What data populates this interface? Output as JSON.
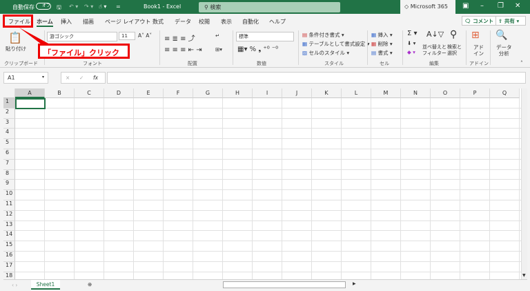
{
  "titlebar": {
    "autosave": "自動保存",
    "autosave_state": "オフ",
    "title": "Book1 - Excel",
    "search_placeholder": "検索",
    "ms365": "Microsoft 365",
    "bg": "#217346"
  },
  "tabs": [
    "ファイル",
    "ホーム",
    "挿入",
    "描画",
    "ページ レイアウト",
    "数式",
    "データ",
    "校閲",
    "表示",
    "自動化",
    "ヘルプ"
  ],
  "comment_button": "コメント",
  "share_button": "共有",
  "ribbon": {
    "clipboard": {
      "paste": "貼り付け",
      "group": "クリップボード"
    },
    "font": {
      "name": "游ゴシック",
      "size": "11",
      "group": "フォント"
    },
    "alignment": {
      "group": "配置"
    },
    "number": {
      "format": "標準",
      "group": "数値"
    },
    "styles": {
      "conditional": "条件付き書式",
      "table": "テーブルとして書式設定",
      "cell_styles": "セルのスタイル",
      "group": "スタイル"
    },
    "cells": {
      "insert": "挿入",
      "delete": "削除",
      "format": "書式",
      "group": "セル"
    },
    "editing": {
      "sort": "並べ替えと\nフィルター",
      "find": "検索と\n選択",
      "group": "編集"
    },
    "addins": {
      "addin": "アド\nイン",
      "group": "アドイン"
    },
    "analysis": {
      "label": "データ\n分析"
    }
  },
  "callout": "「ファイル」クリック",
  "formula_bar": {
    "name_box": "A1",
    "fx": "fx",
    "cancel": "×",
    "enter": "✓",
    "value": ""
  },
  "columns": [
    "A",
    "B",
    "C",
    "D",
    "E",
    "F",
    "G",
    "H",
    "I",
    "J",
    "K",
    "L",
    "M",
    "N",
    "O",
    "P",
    "Q"
  ],
  "rows": [
    "1",
    "2",
    "3",
    "4",
    "5",
    "6",
    "7",
    "8",
    "9",
    "10",
    "11",
    "12",
    "13",
    "14",
    "15",
    "16",
    "17",
    "18"
  ],
  "sheet_tabs": [
    "Sheet1"
  ],
  "accent": "#217346",
  "highlight": "#ee0000"
}
